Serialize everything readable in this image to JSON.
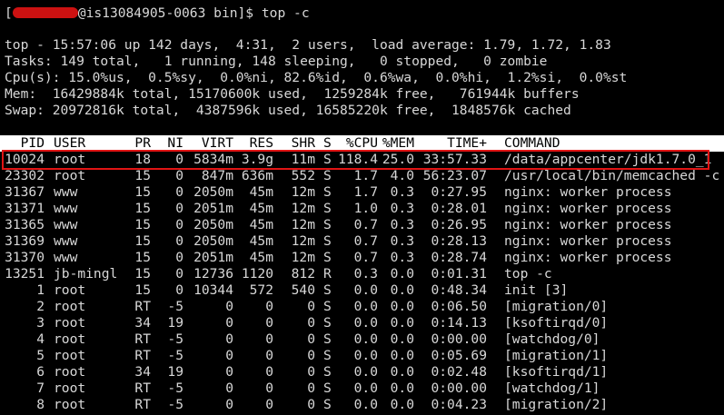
{
  "prompt": {
    "bracket": "[",
    "host": "@is13084905-0063 bin]$ ",
    "command": "top -c"
  },
  "summary": {
    "top_line": "top - 15:57:06 up 142 days,  4:31,  2 users,  load average: 1.79, 1.72, 1.83",
    "tasks_line": "Tasks: 149 total,   1 running, 148 sleeping,   0 stopped,   0 zombie",
    "cpu_line": "Cpu(s): 15.0%us,  0.5%sy,  0.0%ni, 82.6%id,  0.6%wa,  0.0%hi,  1.2%si,  0.0%st",
    "mem_line": "Mem:  16429884k total, 15170600k used,  1259284k free,   761944k buffers",
    "swap_line": "Swap: 20972816k total,  4387596k used, 16585220k free,  1848576k cached"
  },
  "columns": {
    "pid": "PID",
    "user": "USER",
    "pr": "PR",
    "ni": "NI",
    "virt": "VIRT",
    "res": "RES",
    "shr": "SHR",
    "s": "S",
    "cpu": "%CPU",
    "mem": "%MEM",
    "time": "TIME+",
    "command": "COMMAND"
  },
  "processes": [
    {
      "pid": "10024",
      "user": "root",
      "pr": "18",
      "ni": "0",
      "virt": "5834m",
      "res": "3.9g",
      "shr": "11m",
      "s": "S",
      "cpu": "118.4",
      "mem": "25.0",
      "time": "33:57.33",
      "command": "/data/appcenter/jdk1.7.0_1"
    },
    {
      "pid": "23302",
      "user": "root",
      "pr": "15",
      "ni": "0",
      "virt": "847m",
      "res": "636m",
      "shr": "552",
      "s": "S",
      "cpu": "1.7",
      "mem": "4.0",
      "time": "56:23.07",
      "command": "/usr/local/bin/memcached -c"
    },
    {
      "pid": "31367",
      "user": "www",
      "pr": "15",
      "ni": "0",
      "virt": "2050m",
      "res": "45m",
      "shr": "12m",
      "s": "S",
      "cpu": "1.7",
      "mem": "0.3",
      "time": "0:27.95",
      "command": "nginx: worker process"
    },
    {
      "pid": "31371",
      "user": "www",
      "pr": "15",
      "ni": "0",
      "virt": "2051m",
      "res": "45m",
      "shr": "12m",
      "s": "S",
      "cpu": "1.0",
      "mem": "0.3",
      "time": "0:28.01",
      "command": "nginx: worker process"
    },
    {
      "pid": "31365",
      "user": "www",
      "pr": "15",
      "ni": "0",
      "virt": "2050m",
      "res": "45m",
      "shr": "12m",
      "s": "S",
      "cpu": "0.7",
      "mem": "0.3",
      "time": "0:26.95",
      "command": "nginx: worker process"
    },
    {
      "pid": "31369",
      "user": "www",
      "pr": "15",
      "ni": "0",
      "virt": "2050m",
      "res": "45m",
      "shr": "12m",
      "s": "S",
      "cpu": "0.7",
      "mem": "0.3",
      "time": "0:28.13",
      "command": "nginx: worker process"
    },
    {
      "pid": "31370",
      "user": "www",
      "pr": "15",
      "ni": "0",
      "virt": "2051m",
      "res": "45m",
      "shr": "12m",
      "s": "S",
      "cpu": "0.7",
      "mem": "0.3",
      "time": "0:28.74",
      "command": "nginx: worker process"
    },
    {
      "pid": "13251",
      "user": "jb-mingl",
      "pr": "15",
      "ni": "0",
      "virt": "12736",
      "res": "1120",
      "shr": "812",
      "s": "R",
      "cpu": "0.3",
      "mem": "0.0",
      "time": "0:01.31",
      "command": "top -c"
    },
    {
      "pid": "1",
      "user": "root",
      "pr": "15",
      "ni": "0",
      "virt": "10344",
      "res": "572",
      "shr": "540",
      "s": "S",
      "cpu": "0.0",
      "mem": "0.0",
      "time": "0:48.34",
      "command": "init [3]"
    },
    {
      "pid": "2",
      "user": "root",
      "pr": "RT",
      "ni": "-5",
      "virt": "0",
      "res": "0",
      "shr": "0",
      "s": "S",
      "cpu": "0.0",
      "mem": "0.0",
      "time": "0:06.50",
      "command": "[migration/0]"
    },
    {
      "pid": "3",
      "user": "root",
      "pr": "34",
      "ni": "19",
      "virt": "0",
      "res": "0",
      "shr": "0",
      "s": "S",
      "cpu": "0.0",
      "mem": "0.0",
      "time": "0:14.13",
      "command": "[ksoftirqd/0]"
    },
    {
      "pid": "4",
      "user": "root",
      "pr": "RT",
      "ni": "-5",
      "virt": "0",
      "res": "0",
      "shr": "0",
      "s": "S",
      "cpu": "0.0",
      "mem": "0.0",
      "time": "0:00.00",
      "command": "[watchdog/0]"
    },
    {
      "pid": "5",
      "user": "root",
      "pr": "RT",
      "ni": "-5",
      "virt": "0",
      "res": "0",
      "shr": "0",
      "s": "S",
      "cpu": "0.0",
      "mem": "0.0",
      "time": "0:05.69",
      "command": "[migration/1]"
    },
    {
      "pid": "6",
      "user": "root",
      "pr": "34",
      "ni": "19",
      "virt": "0",
      "res": "0",
      "shr": "0",
      "s": "S",
      "cpu": "0.0",
      "mem": "0.0",
      "time": "0:02.48",
      "command": "[ksoftirqd/1]"
    },
    {
      "pid": "7",
      "user": "root",
      "pr": "RT",
      "ni": "-5",
      "virt": "0",
      "res": "0",
      "shr": "0",
      "s": "S",
      "cpu": "0.0",
      "mem": "0.0",
      "time": "0:00.00",
      "command": "[watchdog/1]"
    },
    {
      "pid": "8",
      "user": "root",
      "pr": "RT",
      "ni": "-5",
      "virt": "0",
      "res": "0",
      "shr": "0",
      "s": "S",
      "cpu": "0.0",
      "mem": "0.0",
      "time": "0:04.23",
      "command": "[migration/2]"
    }
  ],
  "colors": {
    "background": "#000000",
    "foreground": "#d8d8d8",
    "header_bg": "#ffffff",
    "highlight_border": "#e01414"
  }
}
